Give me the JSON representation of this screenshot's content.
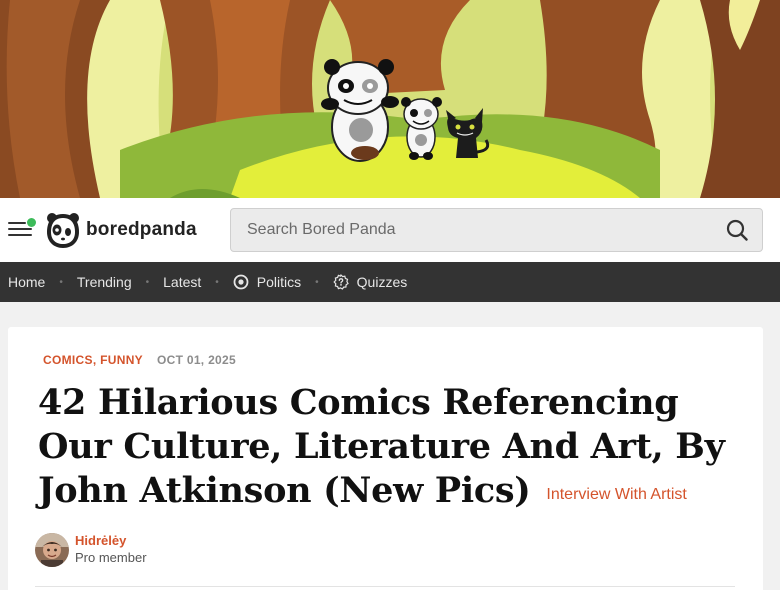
{
  "site": {
    "name": "boredpanda",
    "notification_color": "#3dbb5a"
  },
  "search": {
    "placeholder": "Search Bored Panda",
    "icon": "search-icon"
  },
  "nav": {
    "items": [
      {
        "label": "Home"
      },
      {
        "label": "Trending"
      },
      {
        "label": "Latest"
      },
      {
        "label": "Politics",
        "icon": "politics-icon"
      },
      {
        "label": "Quizzes",
        "icon": "quiz-icon"
      }
    ]
  },
  "article": {
    "categories": [
      "COMICS",
      "FUNNY"
    ],
    "date": "OCT 01, 2025",
    "title": "42 Hilarious Comics Referencing Our Culture, Literature And Art, By John Atkinson (New Pics)",
    "badge": "Interview With Artist",
    "author": {
      "name": "Hidrėlėy",
      "role": "Pro member"
    }
  },
  "colors": {
    "accent": "#d4542c",
    "nav_bg": "#333333",
    "page_bg": "#f1f1f1"
  }
}
